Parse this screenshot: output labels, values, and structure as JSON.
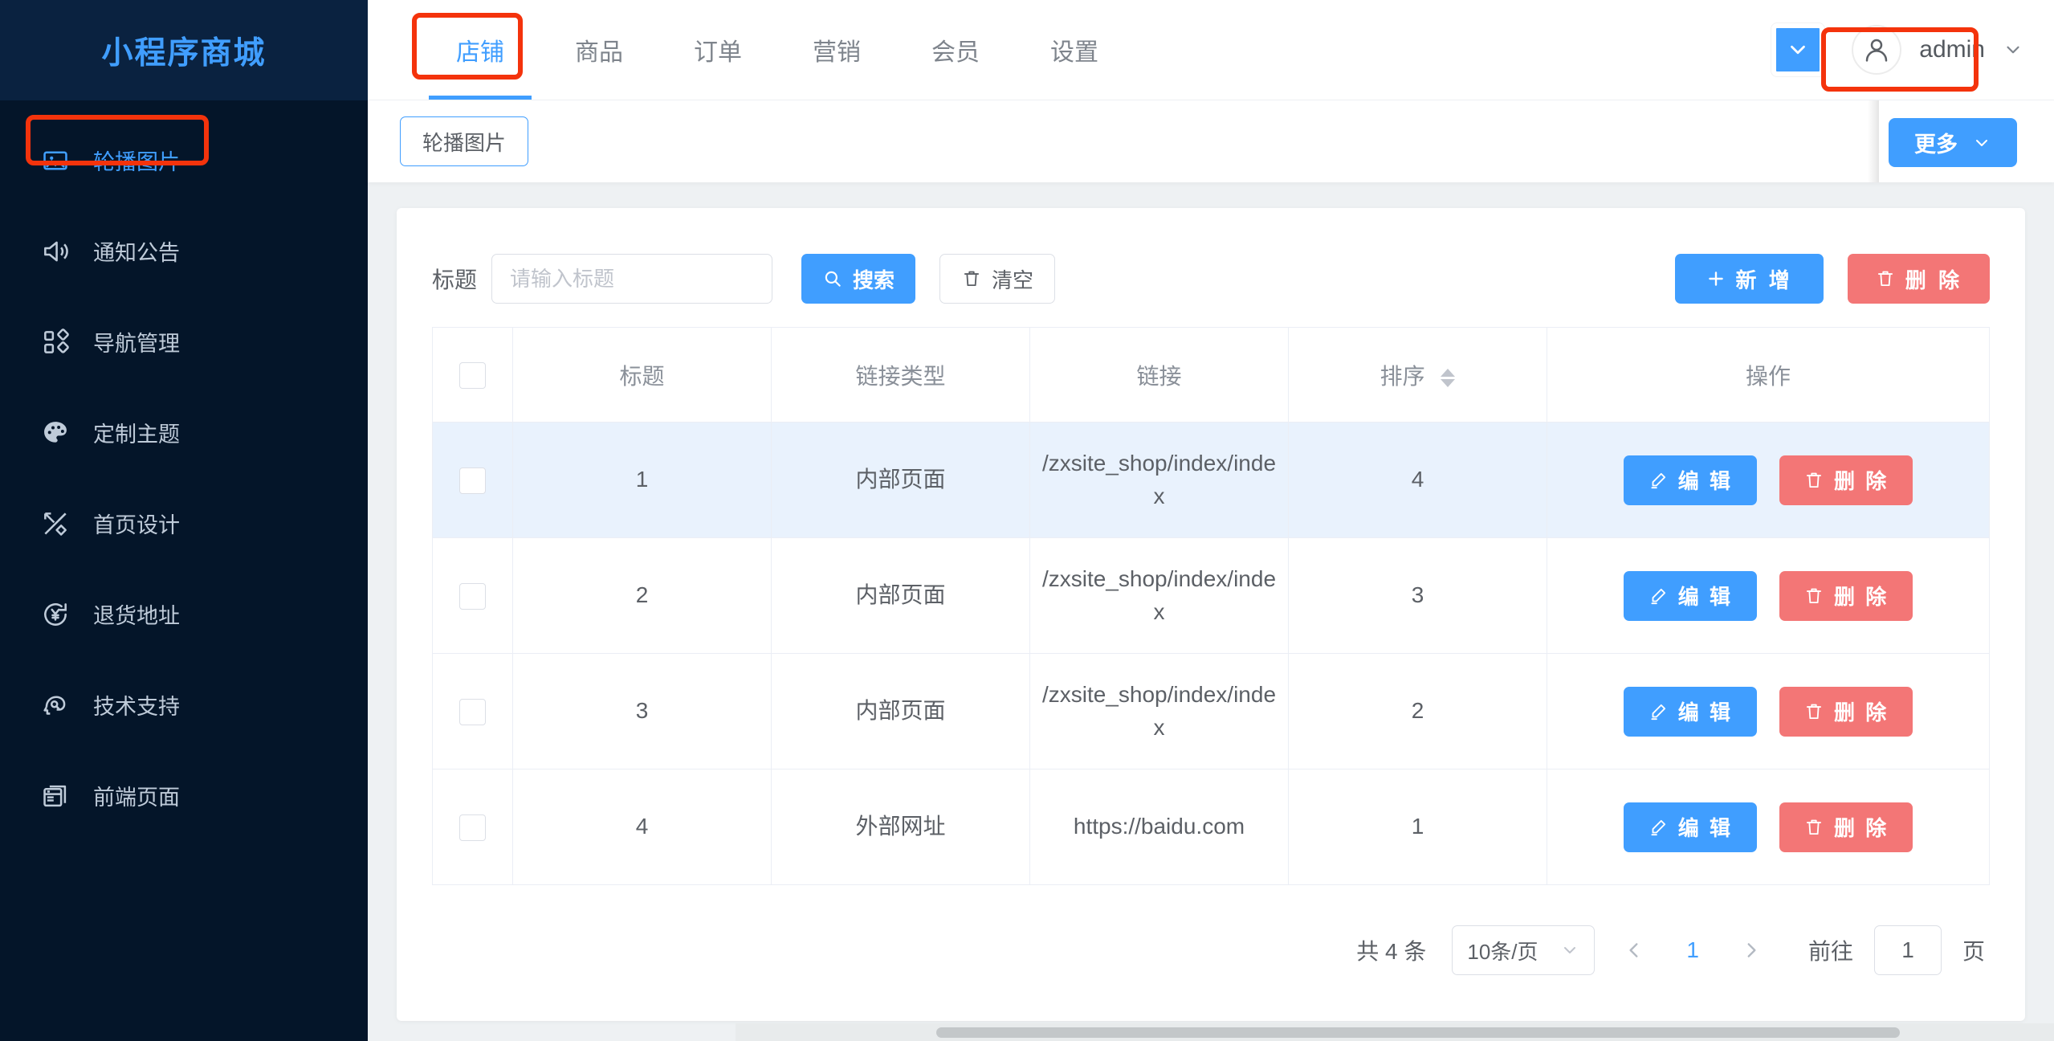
{
  "sidebar": {
    "brand": "小程序商城",
    "items": [
      {
        "label": "轮播图片",
        "icon": "image-icon",
        "active": true
      },
      {
        "label": "通知公告",
        "icon": "megaphone-icon",
        "active": false
      },
      {
        "label": "导航管理",
        "icon": "grid-icon",
        "active": false
      },
      {
        "label": "定制主题",
        "icon": "palette-icon",
        "active": false
      },
      {
        "label": "首页设计",
        "icon": "design-icon",
        "active": false
      },
      {
        "label": "退货地址",
        "icon": "refund-icon",
        "active": false
      },
      {
        "label": "技术支持",
        "icon": "support-icon",
        "active": false
      },
      {
        "label": "前端页面",
        "icon": "window-icon",
        "active": false
      }
    ]
  },
  "header": {
    "tabs": [
      {
        "label": "店铺",
        "active": true
      },
      {
        "label": "商品",
        "active": false
      },
      {
        "label": "订单",
        "active": false
      },
      {
        "label": "营销",
        "active": false
      },
      {
        "label": "会员",
        "active": false
      },
      {
        "label": "设置",
        "active": false
      }
    ],
    "collapse_icon": "chevron-down-icon",
    "avatar_icon": "user-icon",
    "user_name": "admin",
    "user_caret_icon": "chevron-down-icon"
  },
  "subheader": {
    "crumb_tab": "轮播图片",
    "more_label": "更多",
    "more_caret_icon": "chevron-down-icon"
  },
  "toolbar": {
    "title_label": "标题",
    "title_placeholder": "请输入标题",
    "title_value": "",
    "search_label": "搜索",
    "search_icon": "search-icon",
    "clear_label": "清空",
    "clear_icon": "trash-icon",
    "add_label": "新 增",
    "add_icon": "plus-icon",
    "delete_label": "删 除",
    "delete_icon": "trash-icon"
  },
  "table": {
    "columns": [
      "标题",
      "链接类型",
      "链接",
      "排序",
      "操作"
    ],
    "sort_column": "排序",
    "row_edit_label": "编 辑",
    "row_edit_icon": "pencil-icon",
    "row_delete_label": "删 除",
    "row_delete_icon": "trash-icon",
    "rows": [
      {
        "title": "1",
        "link_type": "内部页面",
        "link": "/zxsite_shop/index/index",
        "sort": "4",
        "highlight": true
      },
      {
        "title": "2",
        "link_type": "内部页面",
        "link": "/zxsite_shop/index/index",
        "sort": "3",
        "highlight": false
      },
      {
        "title": "3",
        "link_type": "内部页面",
        "link": "/zxsite_shop/index/index",
        "sort": "2",
        "highlight": false
      },
      {
        "title": "4",
        "link_type": "外部网址",
        "link": "https://baidu.com",
        "sort": "1",
        "highlight": false
      }
    ]
  },
  "pagination": {
    "total_text": "共 4 条",
    "page_size": "10条/页",
    "prev_icon": "chevron-left-icon",
    "current_page": "1",
    "next_icon": "chevron-right-icon",
    "jump_label": "前往",
    "jump_value": "1",
    "jump_unit": "页"
  },
  "colors": {
    "brand_blue": "#409eff",
    "sidebar_bg": "#041529",
    "sidebar_brand_bg": "#0a2240",
    "danger_red": "#f37676",
    "annotation_red": "#f4330c",
    "row_highlight": "#e9f2fd"
  }
}
